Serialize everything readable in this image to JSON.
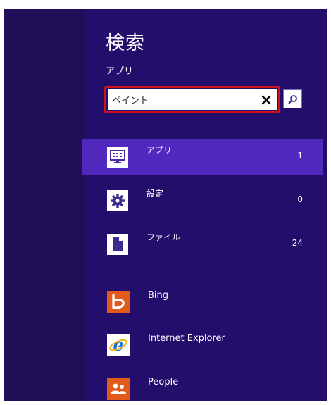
{
  "search": {
    "title": "検索",
    "scope_label": "アプリ",
    "query": "ペイント"
  },
  "categories": [
    {
      "label": "アプリ",
      "count": "1",
      "icon": "keyboard-monitor-icon",
      "selected": true
    },
    {
      "label": "設定",
      "count": "0",
      "icon": "gear-icon",
      "selected": false
    },
    {
      "label": "ファイル",
      "count": "24",
      "icon": "document-icon",
      "selected": false
    }
  ],
  "apps": [
    {
      "label": "Bing",
      "icon": "bing-icon",
      "color": "#e25a1c"
    },
    {
      "label": "Internet Explorer",
      "icon": "internet-explorer-icon",
      "color": "#1f73d8"
    },
    {
      "label": "People",
      "icon": "people-icon",
      "color": "#e25a1c"
    }
  ],
  "colors": {
    "panel": "#230e6b",
    "left_pane": "#1f0f56",
    "selected_row": "#5128be",
    "highlight_outline": "#d0121b"
  }
}
